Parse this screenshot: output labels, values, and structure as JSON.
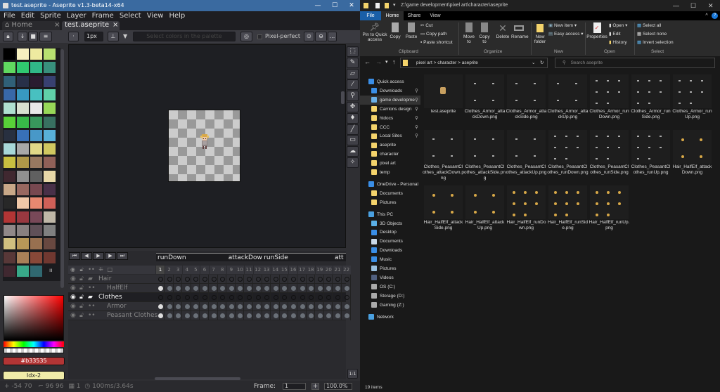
{
  "aseprite": {
    "title": "test.aseprite - Aseprite v1.3-beta14-x64",
    "menu": [
      "File",
      "Edit",
      "Sprite",
      "Layer",
      "Frame",
      "Select",
      "View",
      "Help"
    ],
    "tabs": [
      {
        "label": "Home",
        "active": false
      },
      {
        "label": "test.aseprite",
        "active": true
      }
    ],
    "toolbar": {
      "brush_size": "1px",
      "color_filter_placeholder": "Select colors in the palette",
      "pixel_perfect_label": "Pixel-perfect",
      "pixel_perfect_checked": false,
      "more": "..."
    },
    "palette": [
      "#000000",
      "#f6f0c0",
      "#eeeaa0",
      "#b8e070",
      "#60d860",
      "#30c870",
      "#30b888",
      "#38907c",
      "#306078",
      "#283048",
      "#2a1c30",
      "#384070",
      "#3868a8",
      "#3898c0",
      "#48c0c0",
      "#60d0a8",
      "#b0e0d0",
      "#d8e0d0",
      "#e8e8e8",
      "#98d858",
      "#58d038",
      "#38b848",
      "#38985c",
      "#387060",
      "#283040",
      "#3870b8",
      "#4898c8",
      "#58b0d8",
      "#a8d8d8",
      "#a8a8a8",
      "#e0d888",
      "#d0c860",
      "#c8c040",
      "#b09848",
      "#987860",
      "#906058",
      "#402830",
      "#909090",
      "#606060",
      "#e8d8a8",
      "#c8a888",
      "#986860",
      "#784850",
      "#483048",
      "#282828",
      "#f0c8a8",
      "#e88870",
      "#d06058",
      "#b33535",
      "#983840",
      "#784858",
      "#c0b8a8",
      "#908888",
      "#888080",
      "#605058",
      "#808080",
      "#d0c080",
      "#b89858",
      "#987050",
      "#684840",
      "#583838",
      "#a88058",
      "#884838",
      "#703830",
      "#402830",
      "#38a888",
      "#306870"
    ],
    "fg_color_hex": "#b33535",
    "bg_color_label": "Idx-2",
    "timeline": {
      "tags": [
        {
          "name": "runDown",
          "from": 1,
          "to": 8
        },
        {
          "name": "attackDown",
          "from": 9,
          "to": 12
        },
        {
          "name": "runSide",
          "from": 13,
          "to": 20
        },
        {
          "name": "att",
          "from": 21,
          "to": 22
        }
      ],
      "frame_count": 22,
      "current_frame": 1,
      "layers": [
        {
          "name": "Hair",
          "group": true,
          "indent": 0,
          "selected": false
        },
        {
          "name": "HalfElf",
          "group": false,
          "indent": 1,
          "selected": false
        },
        {
          "name": "Clothes",
          "group": true,
          "indent": 0,
          "selected": true
        },
        {
          "name": "Armor",
          "group": false,
          "indent": 1,
          "selected": false
        },
        {
          "name": "Peasant Clothes",
          "group": false,
          "indent": 1,
          "selected": false
        }
      ]
    },
    "status": {
      "cursor": "-54  70",
      "size": "96  96",
      "frame": "1",
      "duration": "100ms/3.64s",
      "frame_label": "Frame:",
      "frame_value": "1",
      "zoom": "100.0%",
      "one_to_one": "1:1"
    },
    "tools": [
      "rect-select",
      "pencil",
      "eraser",
      "eyedropper",
      "zoom",
      "move",
      "paint-bucket",
      "line",
      "rectangle",
      "lasso",
      "spray"
    ]
  },
  "explorer": {
    "title": "Z:\\game development\\pixel art\\character\\aseprite",
    "ribbon_tabs": [
      "File",
      "Home",
      "Share",
      "View"
    ],
    "ribbon": {
      "clipboard": {
        "label": "Clipboard",
        "pin": "Pin to Quick access",
        "copy": "Copy",
        "paste": "Paste",
        "cut": "Cut",
        "copy_path": "Copy path",
        "paste_shortcut": "Paste shortcut"
      },
      "organize": {
        "label": "Organize",
        "move_to": "Move to",
        "copy_to": "Copy to",
        "delete": "Delete",
        "rename": "Rename"
      },
      "new": {
        "label": "New",
        "new_folder": "New folder",
        "new_item": "New item",
        "easy_access": "Easy access"
      },
      "open": {
        "label": "Open",
        "properties": "Properties",
        "open": "Open",
        "edit": "Edit",
        "history": "History"
      },
      "select": {
        "label": "Select",
        "select_all": "Select all",
        "select_none": "Select none",
        "invert": "Invert selection"
      }
    },
    "breadcrumb": [
      "pixel art",
      "character",
      "aseprite"
    ],
    "search_placeholder": "Search aseprite",
    "nav": [
      {
        "label": "Quick access",
        "icon": "star",
        "color": "#3a8ee6",
        "level": 0
      },
      {
        "label": "Downloads",
        "icon": "download",
        "color": "#3a8ee6",
        "level": 1,
        "pinned": true
      },
      {
        "label": "game developme",
        "icon": "folder",
        "color": "#6ab0e8",
        "level": 1,
        "pinned": true,
        "selected": true
      },
      {
        "label": "Carrions design",
        "icon": "folder",
        "color": "#f4d36b",
        "level": 1,
        "pinned": true
      },
      {
        "label": "htdocs",
        "icon": "folder",
        "color": "#f4d36b",
        "level": 1,
        "pinned": true
      },
      {
        "label": "CCC",
        "icon": "folder",
        "color": "#f4d36b",
        "level": 1,
        "pinned": true
      },
      {
        "label": "Local Sites",
        "icon": "folder",
        "color": "#f4d36b",
        "level": 1,
        "pinned": true
      },
      {
        "label": "aseprite",
        "icon": "folder",
        "color": "#f4d36b",
        "level": 1
      },
      {
        "label": "character",
        "icon": "folder",
        "color": "#f4d36b",
        "level": 1
      },
      {
        "label": "pixel art",
        "icon": "folder",
        "color": "#f4d36b",
        "level": 1
      },
      {
        "label": "temp",
        "icon": "folder",
        "color": "#f4d36b",
        "level": 1
      },
      {
        "label": "OneDrive - Personal",
        "icon": "cloud",
        "color": "#3a8ee6",
        "level": 0,
        "gap": true
      },
      {
        "label": "Documents",
        "icon": "folder",
        "color": "#f4d36b",
        "level": 1
      },
      {
        "label": "Pictures",
        "icon": "folder",
        "color": "#f4d36b",
        "level": 1
      },
      {
        "label": "This PC",
        "icon": "computer",
        "color": "#4aa0e0",
        "level": 0,
        "gap": true
      },
      {
        "label": "3D Objects",
        "icon": "cube",
        "color": "#5ab0e8",
        "level": 1
      },
      {
        "label": "Desktop",
        "icon": "desktop",
        "color": "#3a8ee6",
        "level": 1
      },
      {
        "label": "Documents",
        "icon": "document",
        "color": "#c8d8e8",
        "level": 1
      },
      {
        "label": "Downloads",
        "icon": "download",
        "color": "#3a8ee6",
        "level": 1
      },
      {
        "label": "Music",
        "icon": "music",
        "color": "#3a8ee6",
        "level": 1
      },
      {
        "label": "Pictures",
        "icon": "picture",
        "color": "#9ac0e0",
        "level": 1
      },
      {
        "label": "Videos",
        "icon": "video",
        "color": "#506080",
        "level": 1
      },
      {
        "label": "OS (C:)",
        "icon": "drive",
        "color": "#aaaaaa",
        "level": 1
      },
      {
        "label": "Storage (D:)",
        "icon": "drive",
        "color": "#aaaaaa",
        "level": 1
      },
      {
        "label": "Gaming (Z:)",
        "icon": "drive",
        "color": "#aaaaaa",
        "level": 1
      },
      {
        "label": "Network",
        "icon": "network",
        "color": "#4aa0e0",
        "level": 0,
        "gap": true
      }
    ],
    "files": [
      "test.aseprite",
      "Clothes_Armor_attackDown.png",
      "Clothes_Armor_attackSide.png",
      "Clothes_Armor_attackUp.png",
      "Clothes_Armor_runDown.png",
      "Clothes_Armor_runSide.png",
      "Clothes_Armor_runUp.png",
      "Clothes_PeasantClothes_attackDown.png",
      "Clothes_PeasantClothes_attackSide.png",
      "Clothes_PeasantClothes_attackUp.png",
      "Clothes_PeasantClothes_runDown.png",
      "Clothes_PeasantClothes_runSide.png",
      "Clothes_PeasantClothes_runUp.png",
      "Hair_HalfElf_attackDown.png",
      "Hair_HalfElf_attackSide.png",
      "Hair_HalfElf_attackUp.png",
      "Hair_HalfElf_runDown.png",
      "Hair_HalfElf_runSide.png",
      "Hair_HalfElf_runUp.png"
    ],
    "status": "19 items"
  }
}
